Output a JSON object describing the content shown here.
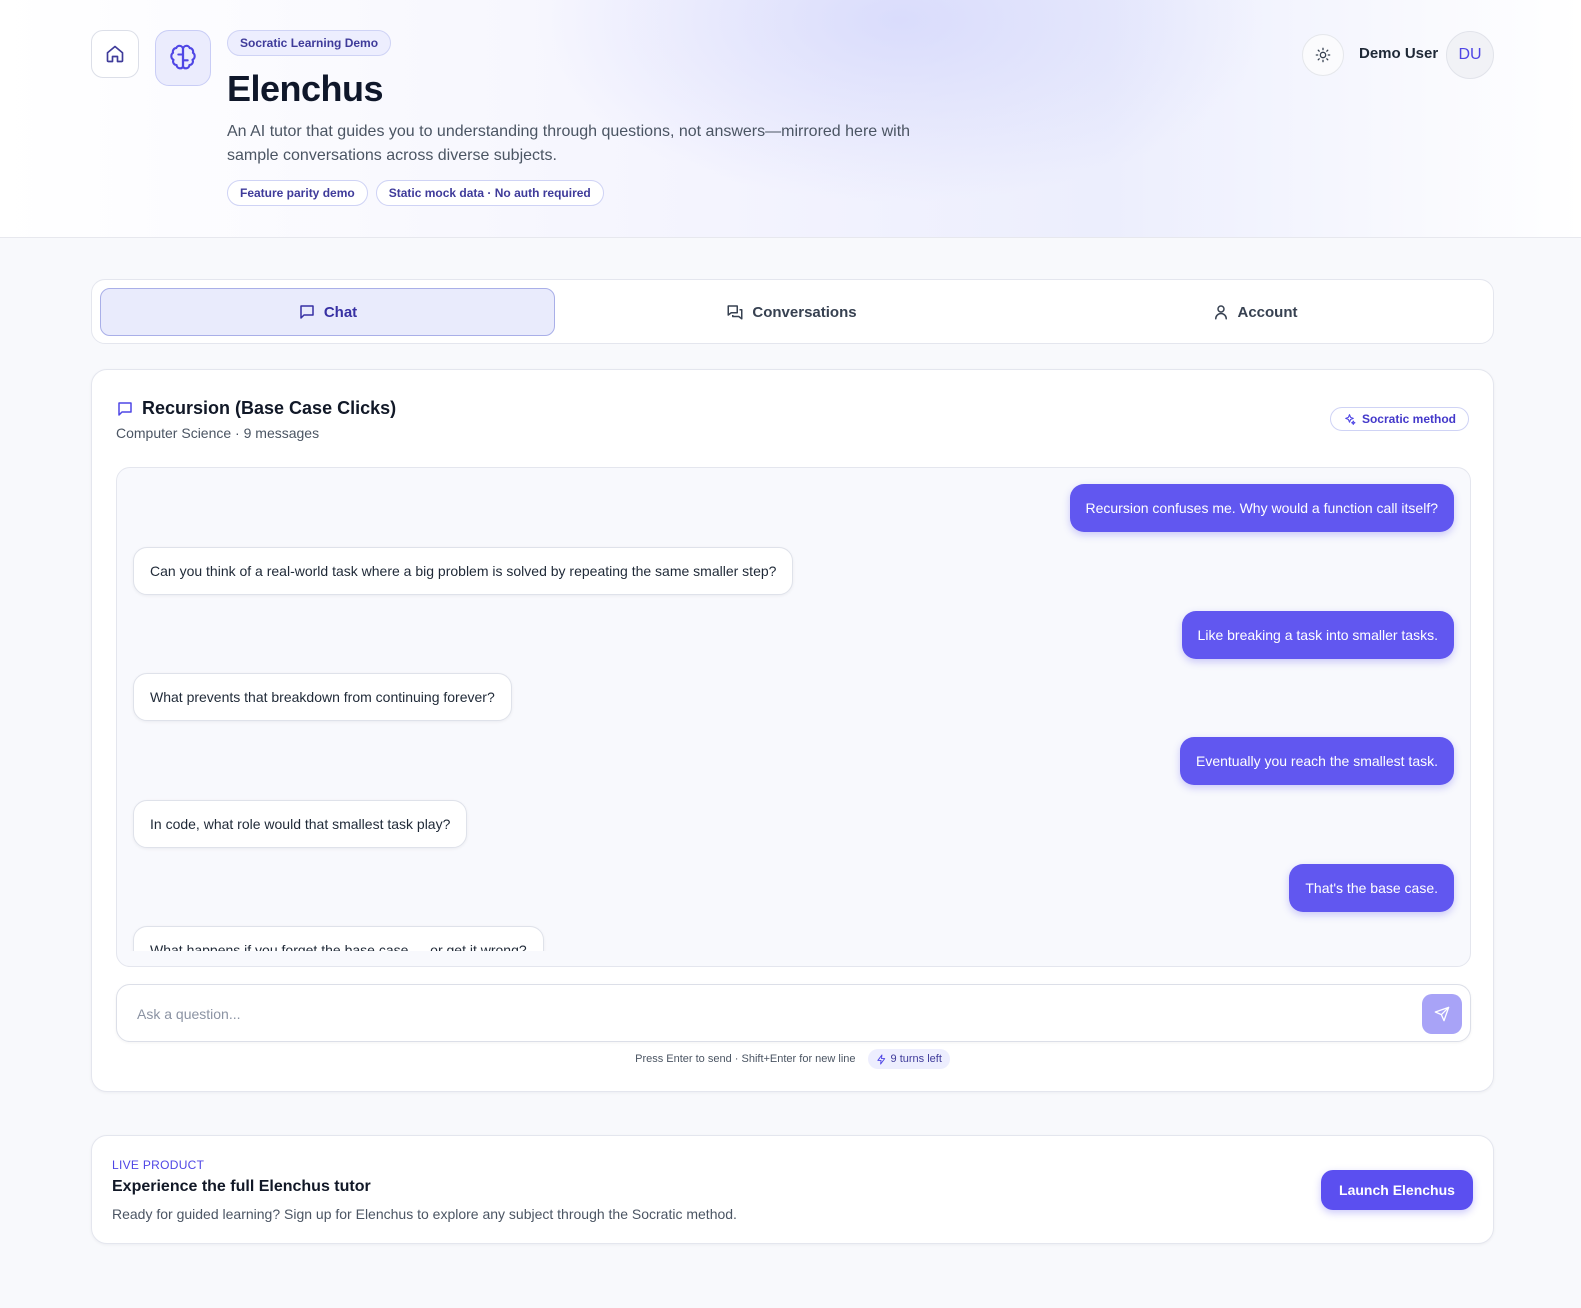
{
  "header": {
    "badge": "Socratic Learning Demo",
    "title": "Elenchus",
    "description": "An AI tutor that guides you to understanding through questions, not answers—mirrored here with sample conversations across diverse subjects.",
    "tags": [
      "Feature parity demo",
      "Static mock data · No auth required"
    ],
    "user_name": "Demo User",
    "avatar_initials": "DU"
  },
  "tabs": [
    {
      "label": "Chat",
      "active": true,
      "icon": "chat-bubble-icon"
    },
    {
      "label": "Conversations",
      "active": false,
      "icon": "conversations-icon"
    },
    {
      "label": "Account",
      "active": false,
      "icon": "user-icon"
    }
  ],
  "conversation": {
    "title": "Recursion (Base Case Clicks)",
    "meta": "Computer Science · 9 messages",
    "method_badge": "Socratic method",
    "messages": [
      {
        "role": "user",
        "text": "Recursion confuses me. Why would a function call itself?"
      },
      {
        "role": "tutor",
        "text": "Can you think of a real-world task where a big problem is solved by repeating the same smaller step?"
      },
      {
        "role": "user",
        "text": "Like breaking a task into smaller tasks."
      },
      {
        "role": "tutor",
        "text": "What prevents that breakdown from continuing forever?"
      },
      {
        "role": "user",
        "text": "Eventually you reach the smallest task."
      },
      {
        "role": "tutor",
        "text": "In code, what role would that smallest task play?"
      },
      {
        "role": "user",
        "text": "That's the base case."
      },
      {
        "role": "tutor",
        "text": "What happens if you forget the base case — or get it wrong?"
      }
    ]
  },
  "composer": {
    "placeholder": "Ask a question...",
    "hint": "Press Enter to send · Shift+Enter for new line",
    "turns_left": "9 turns left"
  },
  "cta": {
    "kicker": "LIVE PRODUCT",
    "title": "Experience the full Elenchus tutor",
    "description": "Ready for guided learning? Sign up for Elenchus to explore any subject through the Socratic method.",
    "button": "Launch Elenchus"
  },
  "colors": {
    "accent": "#5b4ff0",
    "user_bubble": "#6157f0",
    "page_bg": "#f8f9fc"
  }
}
